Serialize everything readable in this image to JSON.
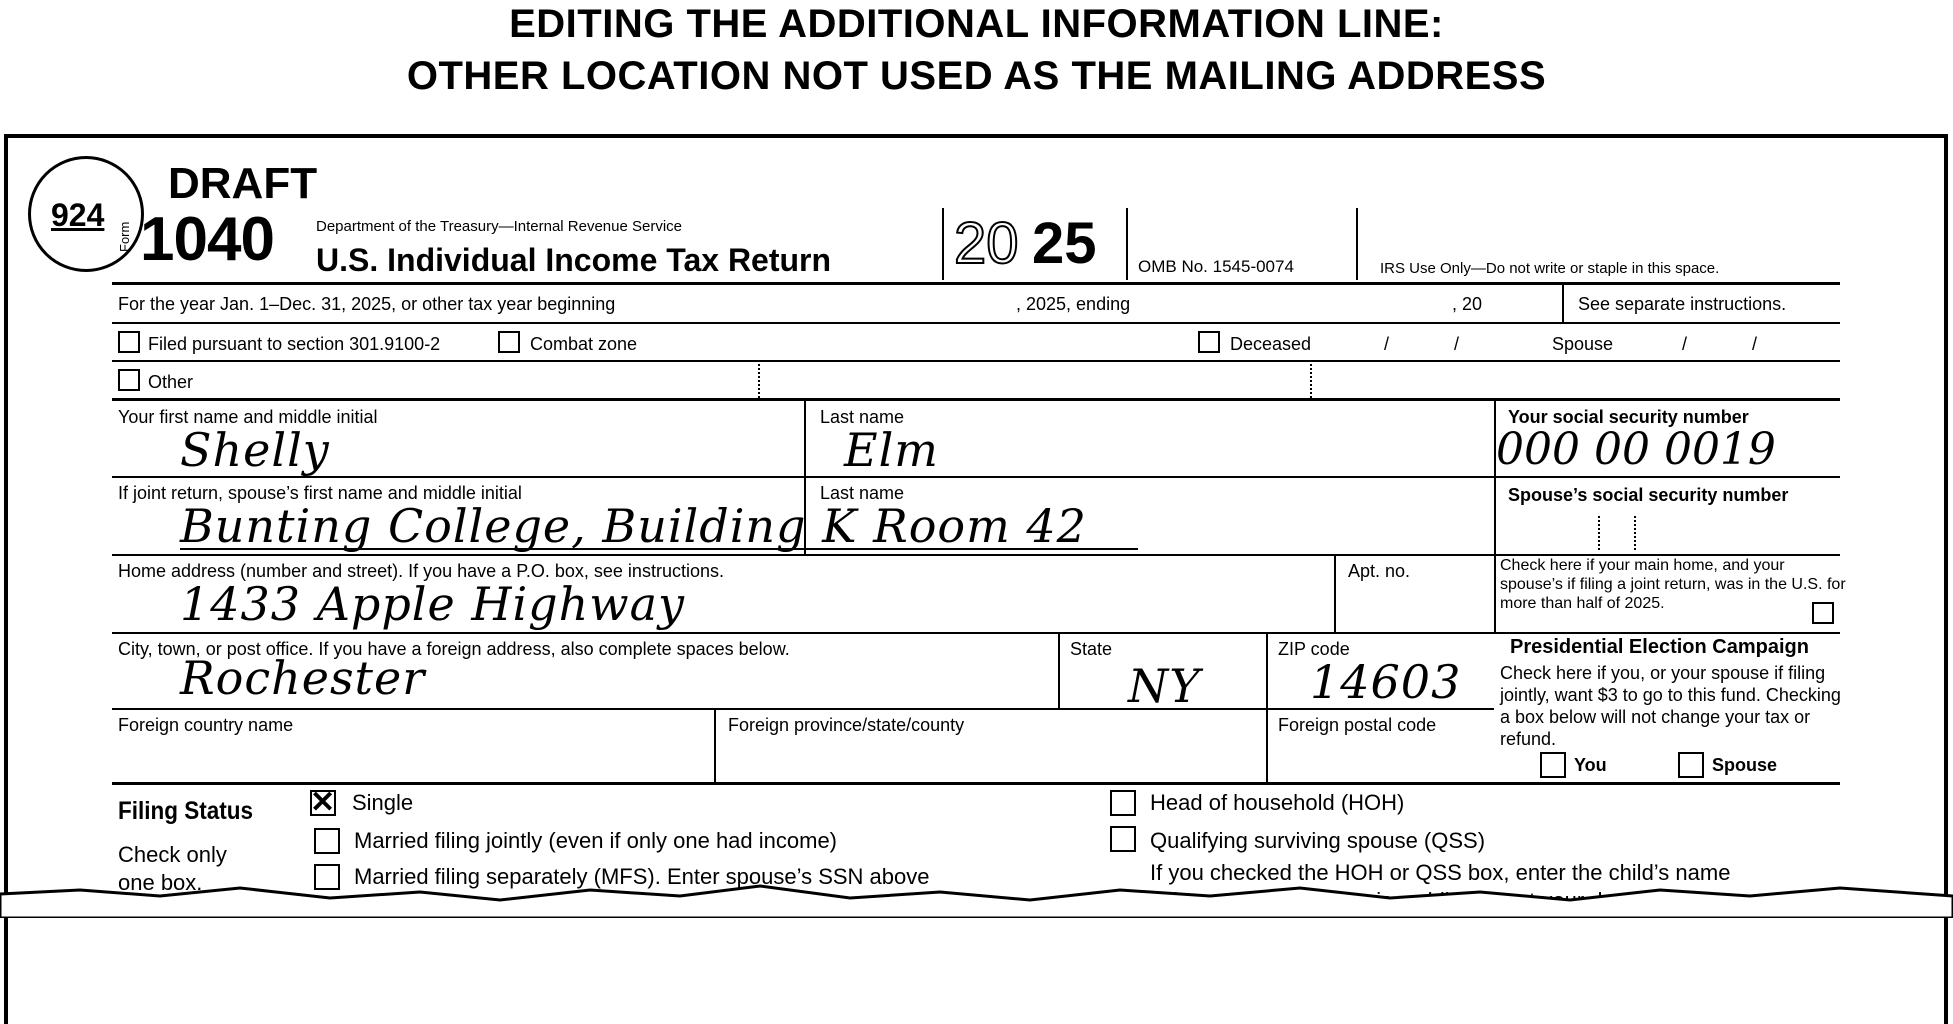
{
  "header": {
    "line1": "EDITING THE ADDITIONAL INFORMATION LINE:",
    "line2": "OTHER LOCATION NOT USED AS THE MAILING ADDRESS"
  },
  "form": {
    "seal_number": "924",
    "draft": "DRAFT",
    "form_word": "Form",
    "form_number": "1040",
    "agency": "Department of the Treasury—Internal Revenue Service",
    "title": "U.S. Individual Income Tax Return",
    "year_outline": "20",
    "year_solid": "25",
    "omb": "OMB No. 1545-0074",
    "irs_use": "IRS Use Only—Do not write or staple in this space.",
    "year_line": {
      "text": "For the year Jan. 1–Dec. 31, 2025, or other tax year beginning",
      "ending": ", 2025, ending",
      "twenty": ", 20",
      "instructions": "See separate instructions."
    },
    "special": {
      "filed_pursuant": "Filed pursuant to section 301.9100-2",
      "combat_zone": "Combat zone",
      "deceased": "Deceased",
      "slash": "/",
      "spouse": "Spouse",
      "other": "Other"
    },
    "name_row": {
      "first_label": "Your first name and middle initial",
      "first_value": "Shelly",
      "last_label": "Last name",
      "last_value": "Elm",
      "ssn_label": "Your social security number",
      "ssn_value": "000 00 0019"
    },
    "spouse_row": {
      "first_label": "If joint return, spouse’s first name and middle initial",
      "value": "Bunting College, Building K Room 42",
      "last_label": "Last name",
      "ssn_label": "Spouse’s social security number"
    },
    "address_row": {
      "label": "Home address (number and street). If you have a P.O. box, see instructions.",
      "value": "1433 Apple Highway",
      "apt_label": "Apt. no.",
      "main_home": "Check here if your main home, and your spouse’s if filing a joint return, was in the U.S. for more than half of 2025."
    },
    "city_row": {
      "city_label": "City, town, or post office. If you have a foreign address, also complete spaces below.",
      "city_value": "Rochester",
      "state_label": "State",
      "state_value": "NY",
      "zip_label": "ZIP code",
      "zip_value": "14603"
    },
    "pec": {
      "title": "Presidential Election Campaign",
      "text": "Check here if you, or your spouse if filing jointly, want $3 to go to this fund. Checking a box below will not change your tax or refund.",
      "you": "You",
      "spouse": "Spouse"
    },
    "foreign_row": {
      "country": "Foreign country name",
      "province": "Foreign province/state/county",
      "postal": "Foreign postal code"
    },
    "filing_status": {
      "title": "Filing Status",
      "check_only": "Check only",
      "one_box": "one box.",
      "single": "Single",
      "mfj": "Married filing jointly (even if only one had income)",
      "mfs": "Married filing separately (MFS). Enter spouse’s SSN above",
      "hoh": "Head of household (HOH)",
      "qss": "Qualifying surviving spouse (QSS)",
      "hoh_note": "If you checked the HOH or QSS box, enter the child’s name",
      "hoh_note2": "if the qualifying person is a child but not your dependent:"
    }
  }
}
